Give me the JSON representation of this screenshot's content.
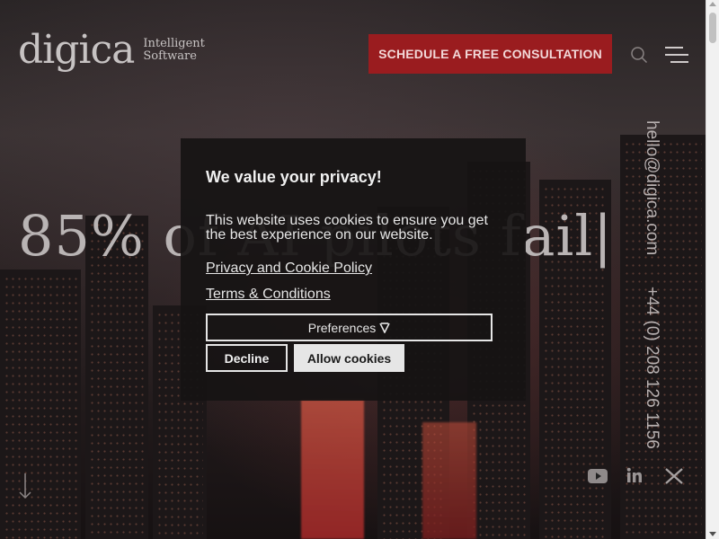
{
  "header": {
    "logo_text": "digica",
    "logo_tagline_line1": "Intelligent",
    "logo_tagline_line2": "Software",
    "cta_label": "SCHEDULE A FREE CONSULTATION",
    "search_icon": "search-icon",
    "menu_icon": "hamburger-menu-icon"
  },
  "hero": {
    "title": "85% of AI pilots fail|",
    "scroll_icon": "arrow-down-icon"
  },
  "contact": {
    "email": "hello@digica.com",
    "phone": "+44 (0) 208 126 1156"
  },
  "social": {
    "items": [
      "youtube-icon",
      "linkedin-icon",
      "x-icon"
    ]
  },
  "cookie_modal": {
    "title": "We value your privacy!",
    "body": "This website uses cookies to ensure you get the best experience on our website.",
    "privacy_link": "Privacy and Cookie Policy",
    "terms_link": "Terms & Conditions",
    "preferences_label": "Preferences",
    "preferences_icon": "chevron-down-icon",
    "decline_label": "Decline",
    "allow_label": "Allow cookies"
  },
  "colors": {
    "brand_red": "#9a1c1f",
    "modal_bg": "#161414",
    "button_light": "#e6e6e6"
  }
}
